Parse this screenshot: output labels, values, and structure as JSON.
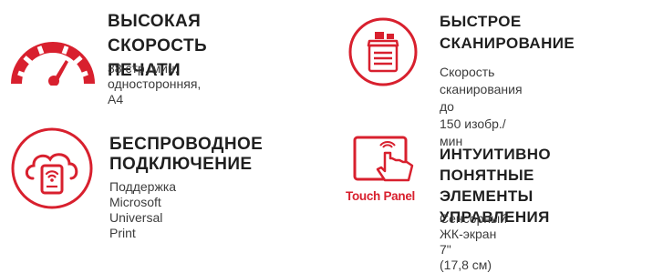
{
  "accent_color": "#d8202e",
  "features": [
    {
      "icon": "speedometer-icon",
      "title": "ВЫСОКАЯ\nСКОРОСТЬ ПЕЧАТИ",
      "description": "38 стр./мин,\nодносторонняя, A4"
    },
    {
      "icon": "scanner-icon",
      "title": "БЫСТРОЕ\nСКАНИРОВАНИЕ",
      "description": "Скорость сканирования до\n150 изобр./мин"
    },
    {
      "icon": "wireless-cloud-icon",
      "title": "БЕСПРОВОДНОЕ\nПОДКЛЮЧЕНИЕ",
      "description": "Поддержка Microsoft\nUniversal Print"
    },
    {
      "icon": "touch-panel-icon",
      "icon_caption": "Touch Panel",
      "title": "ИНТУИТИВНО\nПОНЯТНЫЕ ЭЛЕМЕНТЫ\nУПРАВЛЕНИЯ",
      "description": "Сенсорный ЖК-экран 7\"\n(17,8 см)"
    }
  ]
}
